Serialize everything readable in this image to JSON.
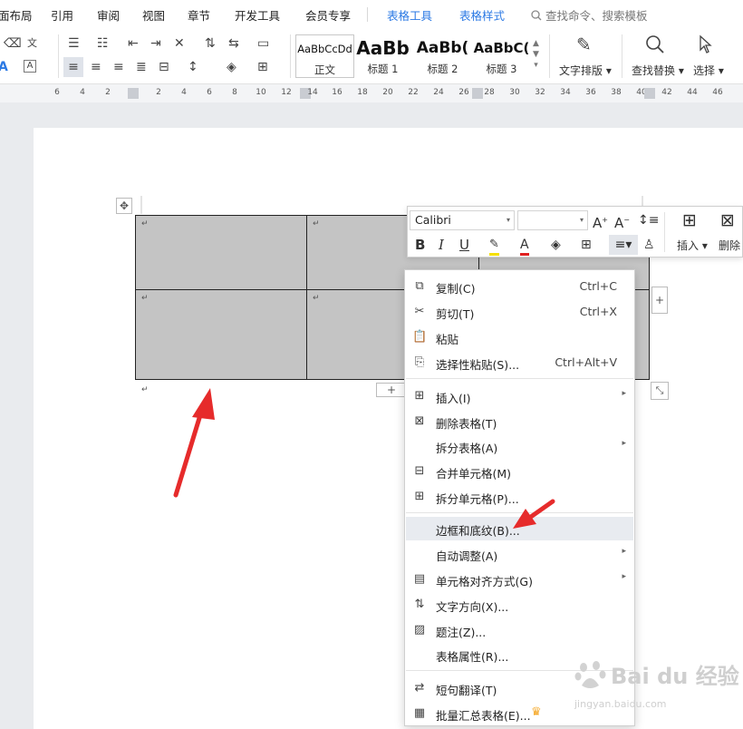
{
  "menubar": {
    "tabs": [
      "面布局",
      "引用",
      "审阅",
      "视图",
      "章节",
      "开发工具",
      "会员专享",
      "表格工具",
      "表格样式"
    ],
    "search": "查找命令、搜索模板"
  },
  "toolbar": {
    "styles": [
      {
        "sample": "AaBbCcDd",
        "name": "正文"
      },
      {
        "sample": "AaBb",
        "name": "标题 1"
      },
      {
        "sample": "AaBb(",
        "name": "标题 2"
      },
      {
        "sample": "AaBbC(",
        "name": "标题 3"
      }
    ],
    "text_layout": "文字排版",
    "find_replace": "查找替换",
    "select": "选择",
    "phonetic_glyph": "文"
  },
  "ruler": {
    "numbers": [
      "6",
      "4",
      "2",
      "2",
      "4",
      "6",
      "8",
      "10",
      "12",
      "14",
      "16",
      "18",
      "20",
      "22",
      "24",
      "26",
      "28",
      "30",
      "32",
      "34",
      "36",
      "38",
      "40",
      "42",
      "44",
      "46"
    ]
  },
  "mini_toolbar": {
    "font": "Calibri",
    "size": "",
    "insert": "插入",
    "delete": "删除"
  },
  "context_menu": {
    "items": [
      {
        "label": "复制(C)",
        "shortcut": "Ctrl+C",
        "icon": "copy-icon"
      },
      {
        "label": "剪切(T)",
        "shortcut": "Ctrl+X",
        "icon": "cut-icon"
      },
      {
        "label": "粘贴",
        "shortcut": "",
        "icon": "paste-icon"
      },
      {
        "label": "选择性粘贴(S)...",
        "shortcut": "Ctrl+Alt+V",
        "icon": "paste-special-icon"
      },
      {
        "label": "插入(I)",
        "shortcut": "",
        "icon": "table-insert-icon"
      },
      {
        "label": "删除表格(T)",
        "shortcut": "",
        "icon": "table-delete-icon"
      },
      {
        "label": "拆分表格(A)",
        "shortcut": "",
        "icon": ""
      },
      {
        "label": "合并单元格(M)",
        "shortcut": "",
        "icon": "merge-cells-icon"
      },
      {
        "label": "拆分单元格(P)...",
        "shortcut": "",
        "icon": "split-cells-icon"
      },
      {
        "label": "边框和底纹(B)...",
        "shortcut": "",
        "icon": ""
      },
      {
        "label": "自动调整(A)",
        "shortcut": "",
        "icon": ""
      },
      {
        "label": "单元格对齐方式(G)",
        "shortcut": "",
        "icon": "cell-align-icon"
      },
      {
        "label": "文字方向(X)...",
        "shortcut": "",
        "icon": "text-direction-icon"
      },
      {
        "label": "题注(Z)...",
        "shortcut": "",
        "icon": "caption-icon"
      },
      {
        "label": "表格属性(R)...",
        "shortcut": "",
        "icon": ""
      },
      {
        "label": "短句翻译(T)",
        "shortcut": "",
        "icon": "translate-icon"
      },
      {
        "label": "批量汇总表格(E)...",
        "shortcut": "",
        "icon": "batch-summary-icon"
      }
    ]
  },
  "watermark": {
    "brand": "Bai du 经验",
    "url": "jingyan.baidu.com"
  },
  "colors": {
    "accent_tab": "#2b79e4",
    "table_fill": "#c4c4c4",
    "arrow_red": "#e62b2b",
    "menu_hover": "#e8ebf0",
    "crown": "#f5a623"
  }
}
